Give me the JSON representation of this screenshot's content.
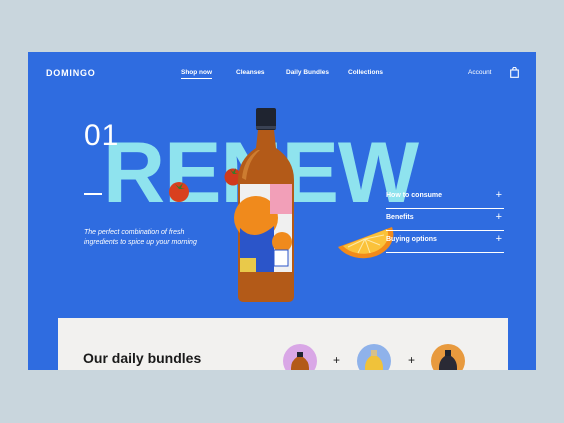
{
  "brand": {
    "logo": "DOMINGO"
  },
  "nav": {
    "items": [
      {
        "label": "Shop now"
      },
      {
        "label": "Cleanses"
      },
      {
        "label": "Daily Bundles"
      },
      {
        "label": "Collections"
      }
    ],
    "account": "Account",
    "bag_icon": "shopping-bag-icon"
  },
  "hero": {
    "slide_number": "01",
    "headline": "RENEW",
    "tagline": "The perfect combination of fresh ingredients to spice up your morning",
    "accordion": [
      {
        "label": "How to consume"
      },
      {
        "label": "Benefits"
      },
      {
        "label": "Buying options"
      }
    ]
  },
  "bundles": {
    "title": "Our daily bundles"
  },
  "colors": {
    "background": "#2f6ce0",
    "headline": "#8fe3ee",
    "page": "#c9d6dd"
  }
}
